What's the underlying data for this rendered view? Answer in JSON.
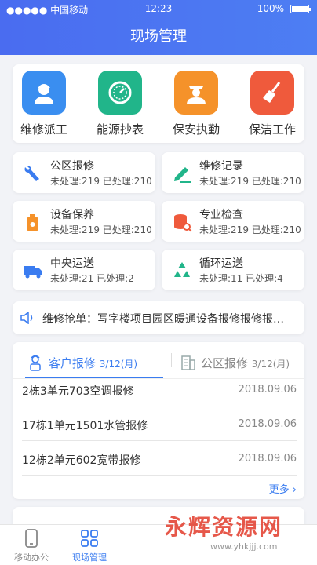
{
  "status_bar": {
    "carrier": "●●●●● 中国移动",
    "time": "12:23",
    "battery": "100%"
  },
  "header": {
    "title": "现场管理"
  },
  "quick_actions": [
    {
      "label": "维修派工",
      "icon": "worker-icon",
      "color": "#3a8ef0"
    },
    {
      "label": "能源抄表",
      "icon": "meter-icon",
      "color": "#21b58a"
    },
    {
      "label": "保安执勤",
      "icon": "guard-icon",
      "color": "#f5922a"
    },
    {
      "label": "保洁工作",
      "icon": "broom-icon",
      "color": "#ef5a3c"
    }
  ],
  "tiles": [
    {
      "name": "公区报修",
      "stats": "未处理:219 已处理:210",
      "icon": "wrench-icon"
    },
    {
      "name": "维修记录",
      "stats": "未处理:219 已处理:210",
      "icon": "pencil-icon"
    },
    {
      "name": "设备保养",
      "stats": "未处理:219 已处理:210",
      "icon": "oil-can-icon"
    },
    {
      "name": "专业检查",
      "stats": "未处理:219 已处理:210",
      "icon": "database-search-icon"
    },
    {
      "name": "中央运送",
      "stats": "未处理:21  已处理:2",
      "icon": "truck-icon"
    },
    {
      "name": "循环运送",
      "stats": "未处理:11  已处理:4",
      "icon": "recycle-icon"
    }
  ],
  "notice": {
    "text": "维修抢单：写字楼项目园区暖通设备报修报修报…"
  },
  "repairs": {
    "tabs": [
      {
        "label": "客户报修",
        "count": "3/12(月)"
      },
      {
        "label": "公区报修",
        "count": "3/12(月)"
      }
    ],
    "rows": [
      {
        "title": "2栋3单元703空调报修",
        "date": "2018.09.06"
      },
      {
        "title": "17栋1单元1501水管报修",
        "date": "2018.09.06"
      },
      {
        "title": "12栋2单元602宽带报修",
        "date": "2018.09.06"
      }
    ],
    "more": "更多"
  },
  "tabbar": [
    {
      "label": "移动办公",
      "icon": "phone-icon",
      "active": false
    },
    {
      "label": "现场管理",
      "icon": "grid-icon",
      "active": true
    }
  ],
  "watermark": {
    "text": "永辉资源网",
    "url": "www.yhkjjj.com"
  },
  "colors": {
    "accent": "#3a7cf0",
    "header_start": "#4a6cf0",
    "header_end": "#4d7ef3"
  }
}
